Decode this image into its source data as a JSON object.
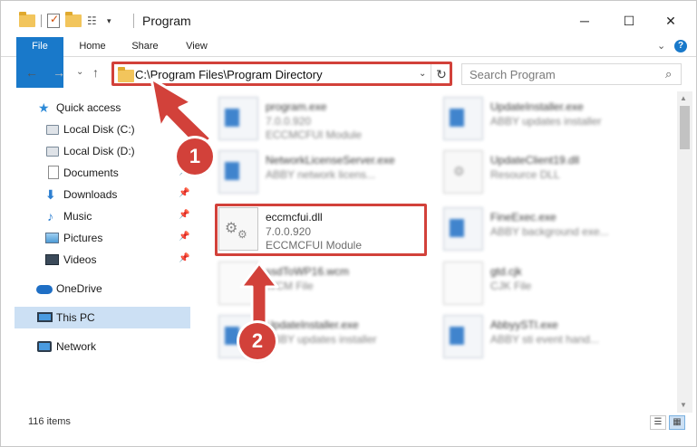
{
  "window": {
    "title": "Program",
    "minimize_glyph": "─",
    "maximize_glyph": "☐",
    "close_glyph": "✕"
  },
  "ribbon": {
    "tabs": [
      {
        "label": "File"
      },
      {
        "label": "Home"
      },
      {
        "label": "Share"
      },
      {
        "label": "View"
      }
    ],
    "expand_glyph": "⌄",
    "help_glyph": "?"
  },
  "navigation": {
    "back_glyph": "←",
    "forward_glyph": "→",
    "recent_glyph": "⌄",
    "up_glyph": "↑",
    "address": "C:\\Program Files\\Program Directory",
    "address_dropdown_glyph": "⌄",
    "refresh_glyph": "↻",
    "search_placeholder": "Search Program",
    "search_glyph": "⌕"
  },
  "sidebar": {
    "items": [
      {
        "label": "Quick access",
        "icon": "star-icon",
        "pinned": false
      },
      {
        "label": "Local Disk (C:)",
        "icon": "disk-icon",
        "pinned": false
      },
      {
        "label": "Local Disk (D:)",
        "icon": "disk-icon",
        "pinned": false
      },
      {
        "label": "Documents",
        "icon": "document-icon",
        "pinned": true
      },
      {
        "label": "Downloads",
        "icon": "download-icon",
        "pinned": true
      },
      {
        "label": "Music",
        "icon": "music-icon",
        "pinned": true
      },
      {
        "label": "Pictures",
        "icon": "pictures-icon",
        "pinned": true
      },
      {
        "label": "Videos",
        "icon": "videos-icon",
        "pinned": true
      },
      {
        "label": "OneDrive",
        "icon": "cloud-icon",
        "pinned": false
      },
      {
        "label": "This PC",
        "icon": "computer-icon",
        "pinned": false,
        "selected": true
      },
      {
        "label": "Network",
        "icon": "network-icon",
        "pinned": false
      }
    ],
    "pin_glyph": "📌"
  },
  "files": [
    {
      "name": "program.exe",
      "line1": "7.0.0.920",
      "line2": "ECCMCFUI Module",
      "type": "exe",
      "blurred": true
    },
    {
      "name": "UpdateInstaller.exe",
      "line1": "ABBY updates installer",
      "line2": "",
      "type": "exe",
      "blurred": true
    },
    {
      "name": "NetworkLicenseServer.exe",
      "line1": "ABBY network licens...",
      "line2": "",
      "type": "exe",
      "blurred": true
    },
    {
      "name": "UpdateClient19.dll",
      "line1": "Resource DLL",
      "line2": "",
      "type": "dll",
      "blurred": true
    },
    {
      "name": "eccmcfui.dll",
      "line1": "7.0.0.920",
      "line2": "ECCMCFUI Module",
      "type": "dll",
      "blurred": false
    },
    {
      "name": "FineExec.exe",
      "line1": "ABBY background exe...",
      "line2": "",
      "type": "exe",
      "blurred": true
    },
    {
      "name": "ssdToWP16.wcm",
      "line1": "WCM File",
      "line2": "",
      "type": "page",
      "blurred": true
    },
    {
      "name": "gtd.cjk",
      "line1": "CJK File",
      "line2": "",
      "type": "page",
      "blurred": true
    },
    {
      "name": "UpdateInstaller.exe",
      "line1": "ABBY updates installer",
      "line2": "",
      "type": "exe",
      "blurred": true
    },
    {
      "name": "AbbyySTI.exe",
      "line1": "ABBY sti event hand...",
      "line2": "",
      "type": "exe",
      "blurred": true
    }
  ],
  "status": {
    "item_count": "116 items",
    "details_view_glyph": "☰",
    "tiles_view_glyph": "▦"
  },
  "annotations": {
    "step1": "1",
    "step2": "2",
    "color": "#d2413a"
  }
}
